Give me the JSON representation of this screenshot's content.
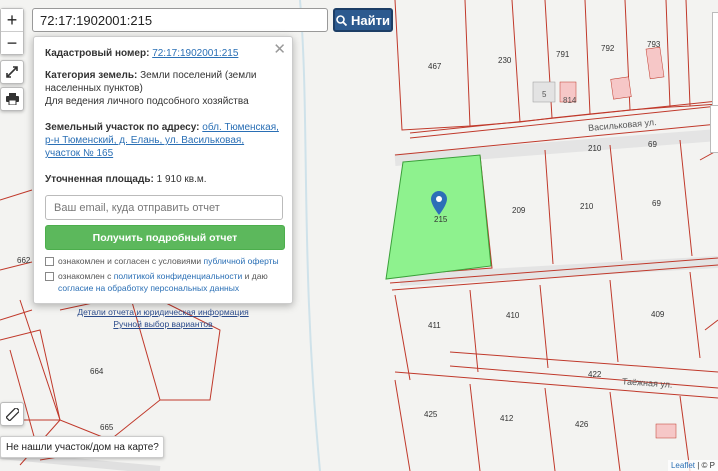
{
  "search": {
    "value": "72:17:1902001:215",
    "button_label": "Найти"
  },
  "popup": {
    "cadastral_label": "Кадастровый номер:",
    "cadastral_value": "72:17:1902001:215",
    "category_label": "Категория земель:",
    "category_value": "Земли поселений (земли населенных пунктов)",
    "usage_value": "Для ведения личного подсобного хозяйства",
    "address_label": "Земельный участок по адресу:",
    "address_value": "обл. Тюменская, р-н Тюменский, д. Елань, ул. Васильковая, участок № 165",
    "area_label": "Уточненная площадь:",
    "area_value": "1 910 кв.м.",
    "email_placeholder": "Ваш email, куда отправить отчет",
    "report_button": "Получить подробный отчет",
    "consent1_text": "ознакомлен и согласен с условиями",
    "consent1_link": "публичной оферты",
    "consent2_text": "ознакомлен с",
    "consent2_link1": "политикой конфиденциальности",
    "consent2_mid": "и даю",
    "consent2_link2": "согласие на обработку персональных данных",
    "details_link": "Детали отчета и юридическая информация",
    "manual_link": "Ручной выбор вариантов"
  },
  "map": {
    "streets": [
      "Васильковая ул.",
      "Таёжная ул."
    ],
    "parcels": [
      "467",
      "230",
      "791",
      "792",
      "793",
      "5",
      "814",
      "210",
      "69",
      "209",
      "210",
      "69",
      "411",
      "410",
      "409",
      "422",
      "664",
      "425",
      "662",
      "665",
      "412",
      "426"
    ],
    "selected_parcel_label": "215",
    "selected_color": "#8ef28e",
    "parcel_line_color": "#c0392b"
  },
  "controls": {
    "zoom_in": "+",
    "zoom_out": "−"
  },
  "not_found_text": "Не нашли участок/дом на карте?",
  "attribution": {
    "leaflet": "Leaflet",
    "rest": "| © P"
  }
}
